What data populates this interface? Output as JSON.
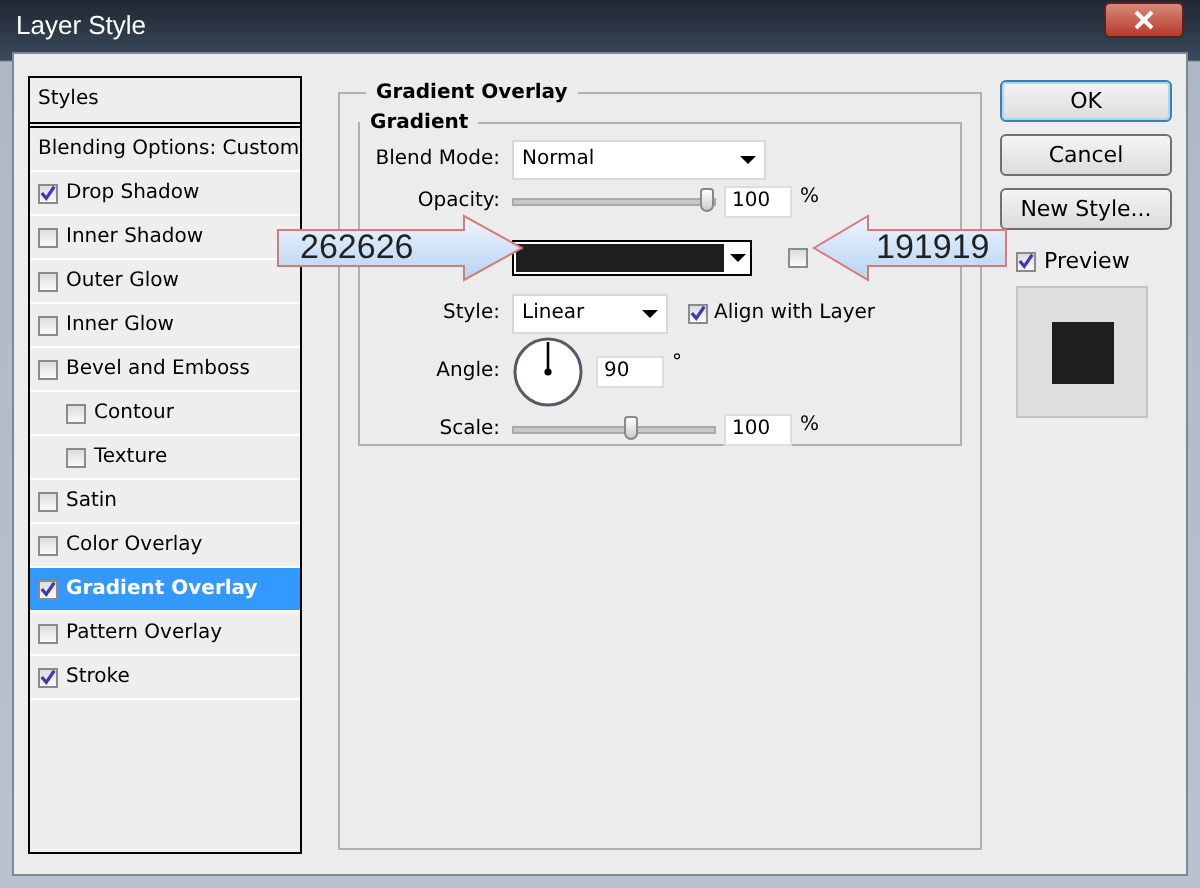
{
  "window": {
    "title": "Layer Style"
  },
  "styles_panel": {
    "header": "Styles",
    "items": [
      {
        "label": "Blending Options: Custom",
        "kind": "plain",
        "selected": false
      },
      {
        "label": "Drop Shadow",
        "kind": "check",
        "checked": true,
        "selected": false
      },
      {
        "label": "Inner Shadow",
        "kind": "check",
        "checked": false,
        "selected": false
      },
      {
        "label": "Outer Glow",
        "kind": "check",
        "checked": false,
        "selected": false
      },
      {
        "label": "Inner Glow",
        "kind": "check",
        "checked": false,
        "selected": false
      },
      {
        "label": "Bevel and Emboss",
        "kind": "check",
        "checked": false,
        "selected": false,
        "children": [
          {
            "label": "Contour",
            "kind": "check",
            "checked": false,
            "selected": false
          },
          {
            "label": "Texture",
            "kind": "check",
            "checked": false,
            "selected": false
          }
        ]
      },
      {
        "label": "Satin",
        "kind": "check",
        "checked": false,
        "selected": false
      },
      {
        "label": "Color Overlay",
        "kind": "check",
        "checked": false,
        "selected": false
      },
      {
        "label": "Gradient Overlay",
        "kind": "check",
        "checked": true,
        "selected": true
      },
      {
        "label": "Pattern Overlay",
        "kind": "check",
        "checked": false,
        "selected": false
      },
      {
        "label": "Stroke",
        "kind": "check",
        "checked": true,
        "selected": false
      }
    ]
  },
  "gradient_overlay": {
    "title": "Gradient Overlay",
    "group_title": "Gradient",
    "blend_mode": {
      "label": "Blend Mode:",
      "value": "Normal"
    },
    "opacity": {
      "label": "Opacity:",
      "level": 1,
      "value": "100",
      "unit": "%"
    },
    "reverse": {
      "checked": false
    },
    "style": {
      "label": "Style:",
      "value": "Linear"
    },
    "align_with_layer": {
      "label": "Align with Layer",
      "checked": true
    },
    "angle": {
      "label": "Angle:",
      "value": "90",
      "unit": "°"
    },
    "scale": {
      "label": "Scale:",
      "level": 0.6,
      "value": "100",
      "unit": "%"
    }
  },
  "buttons": [
    {
      "label": "OK",
      "default": true
    },
    {
      "label": "Cancel",
      "default": false
    },
    {
      "label": "New Style...",
      "default": false
    }
  ],
  "preview": {
    "label": "Preview",
    "checked": true
  },
  "callouts": [
    {
      "text": "262626",
      "kind": "arrow-right"
    },
    {
      "text": "191919",
      "kind": "arrow-left"
    }
  ]
}
